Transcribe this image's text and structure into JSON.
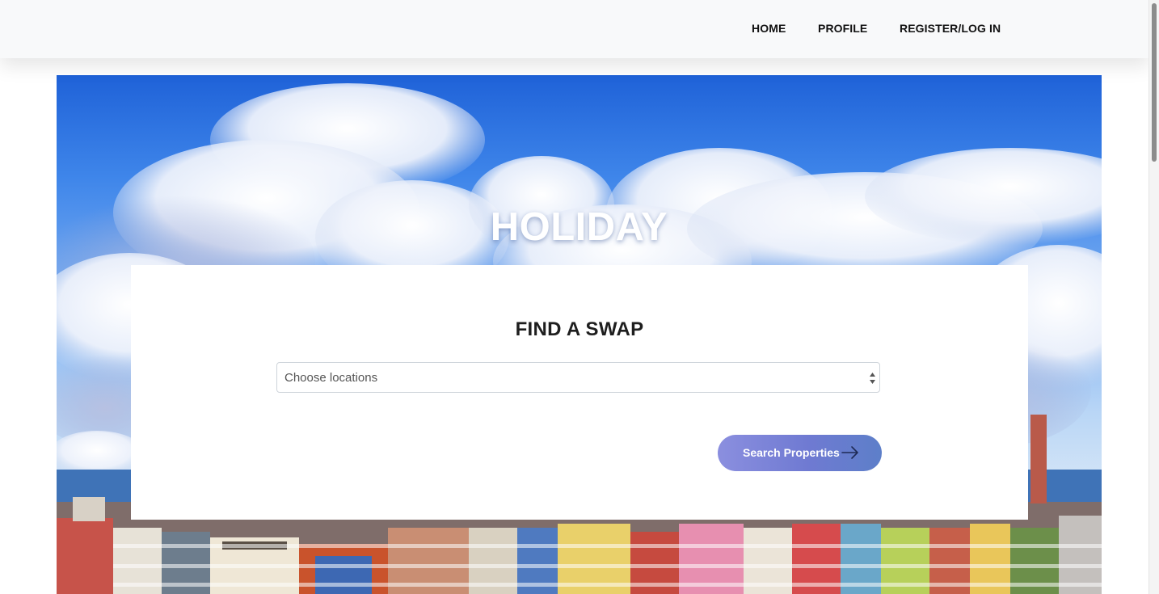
{
  "nav": {
    "items": [
      {
        "label": "HOME"
      },
      {
        "label": "PROFILE"
      },
      {
        "label": "REGISTER/LOG IN"
      }
    ]
  },
  "hero": {
    "title": "HOLIDAY"
  },
  "search": {
    "title": "FIND A SWAP",
    "location_placeholder": "Choose locations",
    "button_label": "Search Properties",
    "button_icon": "arrow-right-icon"
  },
  "colors": {
    "nav_background": "#f8f9fa",
    "button_gradient_start": "#8b8fdf",
    "button_gradient_end": "#5d7fc9",
    "sky": "#3f86ea"
  }
}
